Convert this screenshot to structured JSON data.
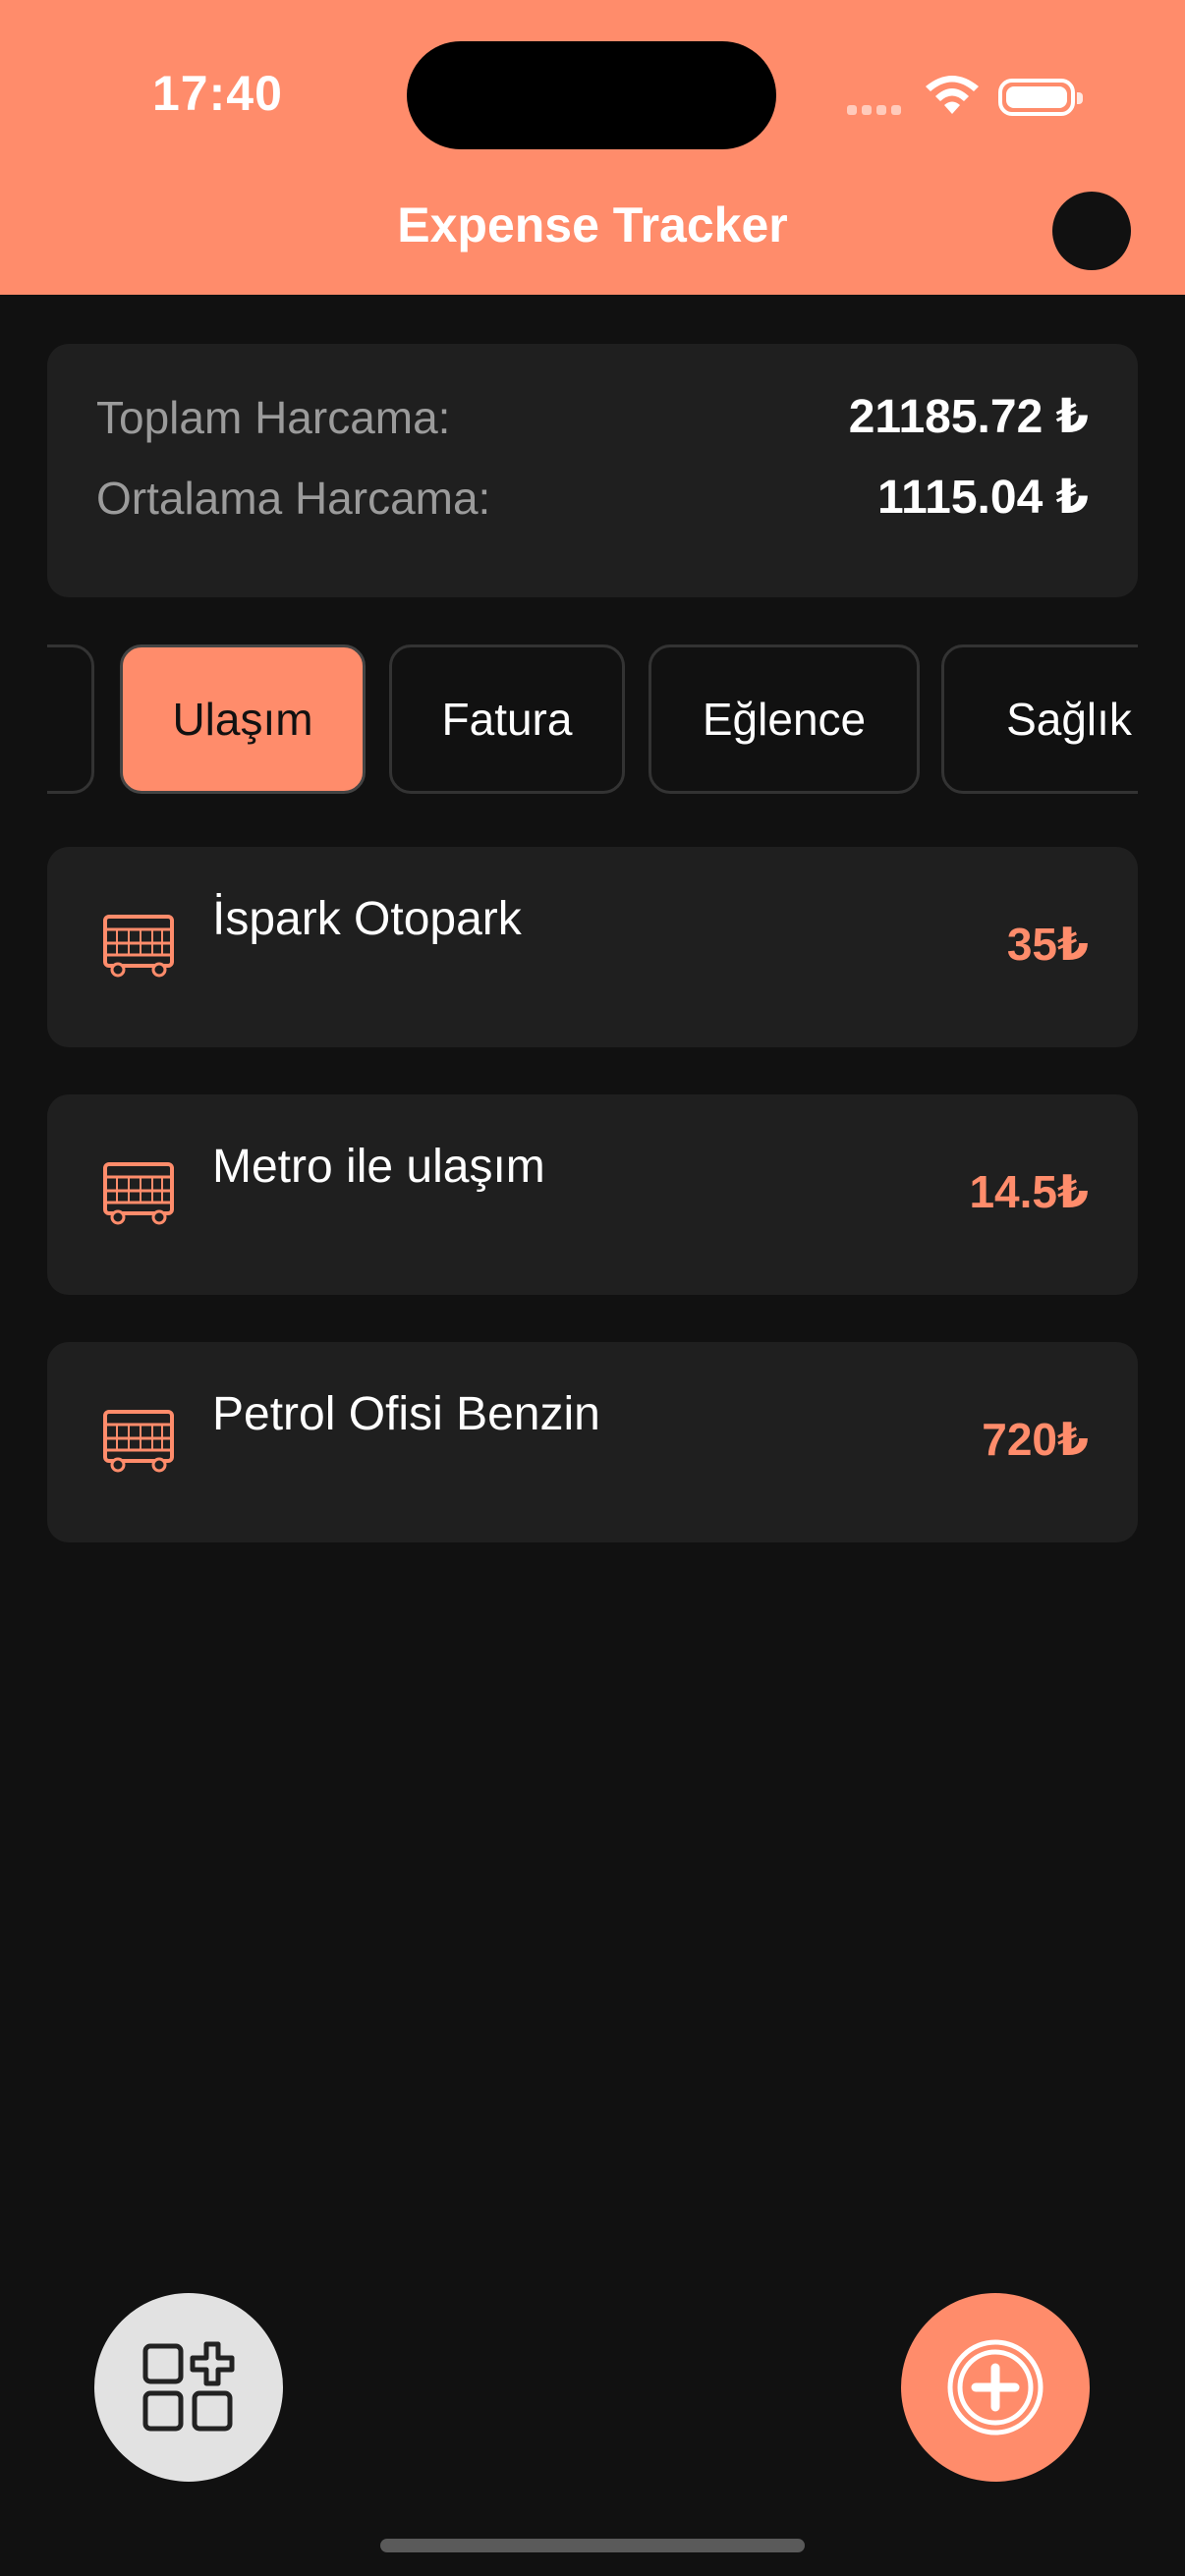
{
  "status_bar": {
    "time": "17:40"
  },
  "header": {
    "title": "Expense Tracker"
  },
  "summary": {
    "total_label": "Toplam Harcama:",
    "total_value": "21185.72 ₺",
    "average_label": "Ortalama Harcama:",
    "average_value": "1115.04 ₺"
  },
  "categories": [
    {
      "label": ""
    },
    {
      "label": "Ulaşım",
      "selected": true
    },
    {
      "label": "Fatura"
    },
    {
      "label": "Eğlence"
    },
    {
      "label": "Sağlık"
    }
  ],
  "expenses": [
    {
      "name": "İspark Otopark",
      "amount": "35₺",
      "icon": "bus-icon"
    },
    {
      "name": "Metro ile ulaşım",
      "amount": "14.5₺",
      "icon": "bus-icon"
    },
    {
      "name": "Petrol Ofisi Benzin",
      "amount": "720₺",
      "icon": "bus-icon"
    }
  ],
  "colors": {
    "accent": "#FF8C6B",
    "background": "#111111",
    "card": "#1f1f1f"
  },
  "actions": {
    "left_icon": "widgets-add-icon",
    "right_icon": "add-circle-icon"
  }
}
